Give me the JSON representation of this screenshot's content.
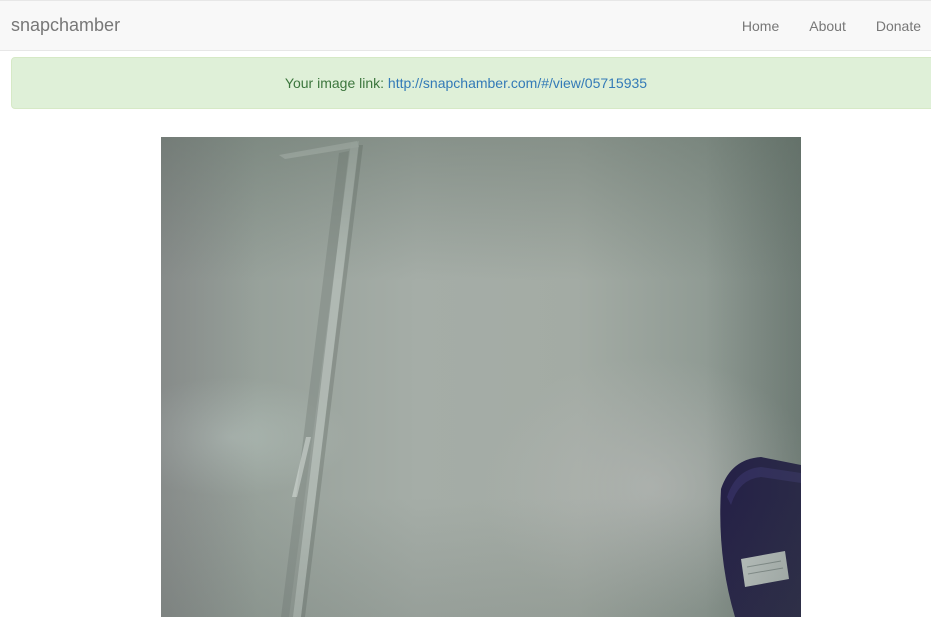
{
  "navbar": {
    "brand": "snapchamber",
    "links": [
      "Home",
      "About",
      "Donate"
    ]
  },
  "alert": {
    "prefix": "Your image link: ",
    "link_text": "http://snapchamber.com/#/view/05715935"
  },
  "photo": {
    "description_icon": "webcam-photo"
  },
  "colors": {
    "navbar_bg": "#f8f8f8",
    "brand_text": "#777777",
    "alert_bg": "#dff0d8",
    "alert_text": "#3c763d",
    "link": "#337ab7"
  }
}
